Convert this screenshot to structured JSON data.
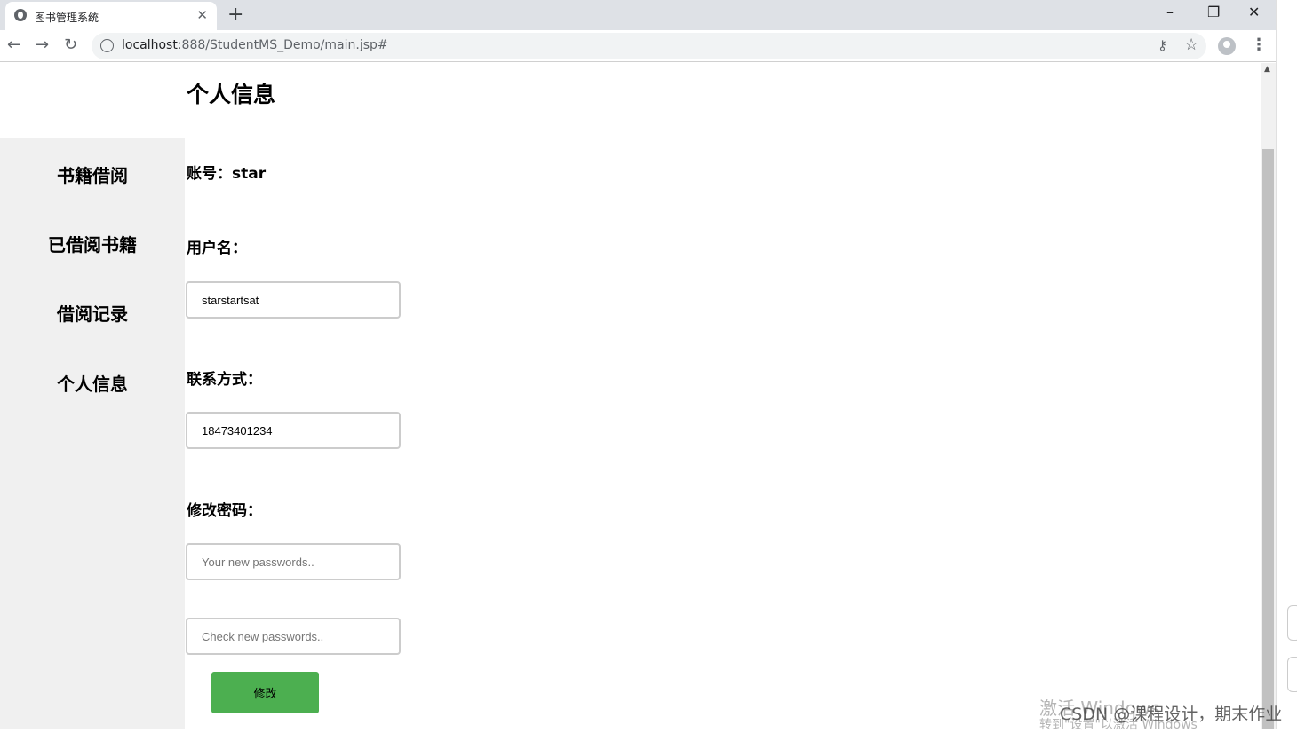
{
  "browser": {
    "tab_title": "图书管理系统",
    "new_tab": "+",
    "url_host": "localhost",
    "url_path": ":888/StudentMS_Demo/main.jsp#",
    "window_controls": {
      "minimize": "–",
      "restore": "❐",
      "close": "✕"
    }
  },
  "page": {
    "title": "个人信息"
  },
  "sidebar": {
    "items": [
      {
        "label": "书籍借阅"
      },
      {
        "label": "已借阅书籍"
      },
      {
        "label": "借阅记录"
      },
      {
        "label": "个人信息"
      }
    ]
  },
  "form": {
    "account_label": "账号：star",
    "username_label": "用户名：",
    "username_value": "starstartsat",
    "contact_label": "联系方式：",
    "contact_value": "18473401234",
    "password_label": "修改密码：",
    "new_password_placeholder": "Your new passwords..",
    "check_password_placeholder": "Check new passwords..",
    "submit_label": "修改"
  },
  "overlay": {
    "activation_watermark": "激活 Windows",
    "activation_hint": "转到\"设置\"以激活 Windows",
    "csdn_watermark": "CSDN @课程设计，期末作业"
  }
}
